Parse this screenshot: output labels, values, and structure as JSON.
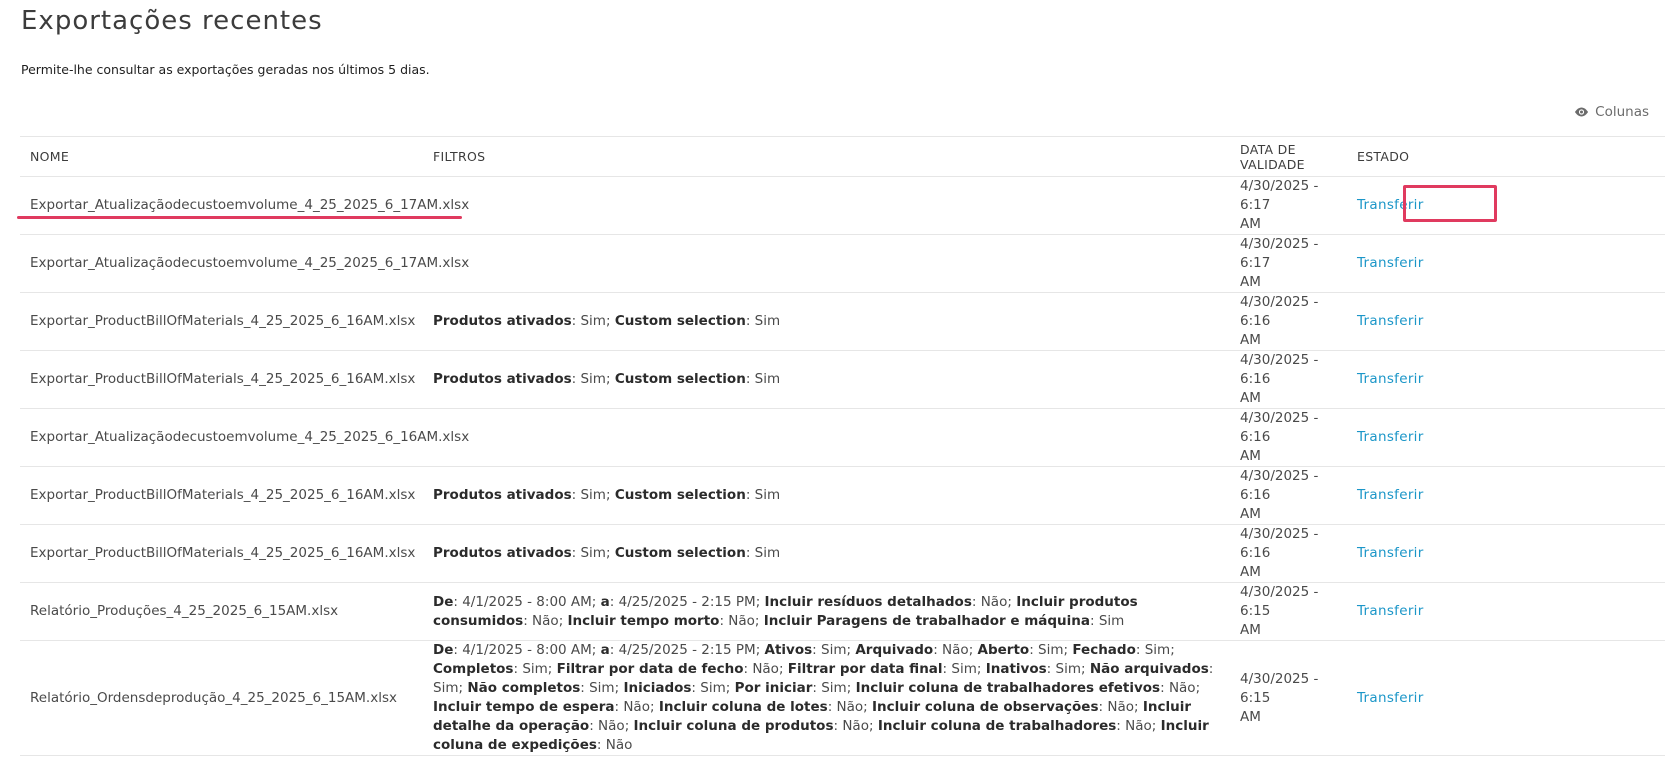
{
  "page": {
    "title": "Exportações recentes",
    "subtitle": "Permite-lhe consultar as exportações geradas nos últimos 5 dias.",
    "columns_button": "Colunas",
    "columns_icon": "eye-icon"
  },
  "table": {
    "headers": {
      "name": "NOME",
      "filters": "FILTROS",
      "date": "DATA DE VALIDADE",
      "state": "ESTADO"
    },
    "rows": [
      {
        "name": "Exportar_Atualizaçãodecustoemvolume_4_25_2025_6_17AM.xlsx",
        "filters": [],
        "date_line1": "4/30/2025 - 6:17",
        "date_line2": "AM",
        "action": "Transferir"
      },
      {
        "name": "Exportar_Atualizaçãodecustoemvolume_4_25_2025_6_17AM.xlsx",
        "filters": [],
        "date_line1": "4/30/2025 - 6:17",
        "date_line2": "AM",
        "action": "Transferir"
      },
      {
        "name": "Exportar_ProductBillOfMaterials_4_25_2025_6_16AM.xlsx",
        "filters": [
          {
            "label": "Produtos ativados",
            "value": "Sim"
          },
          {
            "label": "Custom selection",
            "value": "Sim"
          }
        ],
        "date_line1": "4/30/2025 - 6:16",
        "date_line2": "AM",
        "action": "Transferir"
      },
      {
        "name": "Exportar_ProductBillOfMaterials_4_25_2025_6_16AM.xlsx",
        "filters": [
          {
            "label": "Produtos ativados",
            "value": "Sim"
          },
          {
            "label": "Custom selection",
            "value": "Sim"
          }
        ],
        "date_line1": "4/30/2025 - 6:16",
        "date_line2": "AM",
        "action": "Transferir"
      },
      {
        "name": "Exportar_Atualizaçãodecustoemvolume_4_25_2025_6_16AM.xlsx",
        "filters": [],
        "date_line1": "4/30/2025 - 6:16",
        "date_line2": "AM",
        "action": "Transferir"
      },
      {
        "name": "Exportar_ProductBillOfMaterials_4_25_2025_6_16AM.xlsx",
        "filters": [
          {
            "label": "Produtos ativados",
            "value": "Sim"
          },
          {
            "label": "Custom selection",
            "value": "Sim"
          }
        ],
        "date_line1": "4/30/2025 - 6:16",
        "date_line2": "AM",
        "action": "Transferir"
      },
      {
        "name": "Exportar_ProductBillOfMaterials_4_25_2025_6_16AM.xlsx",
        "filters": [
          {
            "label": "Produtos ativados",
            "value": "Sim"
          },
          {
            "label": "Custom selection",
            "value": "Sim"
          }
        ],
        "date_line1": "4/30/2025 - 6:16",
        "date_line2": "AM",
        "action": "Transferir"
      },
      {
        "name": "Relatório_Produções_4_25_2025_6_15AM.xlsx",
        "filters": [
          {
            "label": "De",
            "value": "4/1/2025 - 8:00 AM"
          },
          {
            "label": "a",
            "value": "4/25/2025 - 2:15 PM"
          },
          {
            "label": "Incluir resíduos detalhados",
            "value": "Não"
          },
          {
            "label": "Incluir produtos consumidos",
            "value": "Não"
          },
          {
            "label": "Incluir tempo morto",
            "value": "Não"
          },
          {
            "label": "Incluir Paragens de trabalhador e máquina",
            "value": "Sim"
          }
        ],
        "date_line1": "4/30/2025 - 6:15",
        "date_line2": "AM",
        "action": "Transferir"
      },
      {
        "name": "Relatório_Ordensdeprodução_4_25_2025_6_15AM.xlsx",
        "filters": [
          {
            "label": "De",
            "value": "4/1/2025 - 8:00 AM"
          },
          {
            "label": "a",
            "value": "4/25/2025 - 2:15 PM"
          },
          {
            "label": "Ativos",
            "value": "Sim"
          },
          {
            "label": "Arquivado",
            "value": "Não"
          },
          {
            "label": "Aberto",
            "value": "Sim"
          },
          {
            "label": "Fechado",
            "value": "Sim"
          },
          {
            "label": "Completos",
            "value": "Sim"
          },
          {
            "label": "Filtrar por data de fecho",
            "value": "Não"
          },
          {
            "label": "Filtrar por data final",
            "value": "Sim"
          },
          {
            "label": "Inativos",
            "value": "Sim"
          },
          {
            "label": "Não arquivados",
            "value": "Sim"
          },
          {
            "label": "Não completos",
            "value": "Sim"
          },
          {
            "label": "Iniciados",
            "value": "Sim"
          },
          {
            "label": "Por iniciar",
            "value": "Sim"
          },
          {
            "label": "Incluir coluna de trabalhadores efetivos",
            "value": "Não"
          },
          {
            "label": "Incluir tempo de espera",
            "value": "Não"
          },
          {
            "label": "Incluir coluna de lotes",
            "value": "Não"
          },
          {
            "label": "Incluir coluna de observações",
            "value": "Não"
          },
          {
            "label": "Incluir detalhe da operação",
            "value": "Não"
          },
          {
            "label": "Incluir coluna de produtos",
            "value": "Não"
          },
          {
            "label": "Incluir coluna de trabalhadores",
            "value": "Não"
          },
          {
            "label": "Incluir coluna de expedições",
            "value": "Não"
          }
        ],
        "date_line1": "4/30/2025 - 6:15",
        "date_line2": "AM",
        "action": "Transferir"
      }
    ]
  },
  "colors": {
    "link": "#1b96c8",
    "annotation": "#e03a5f",
    "border": "#e6e6e6"
  }
}
